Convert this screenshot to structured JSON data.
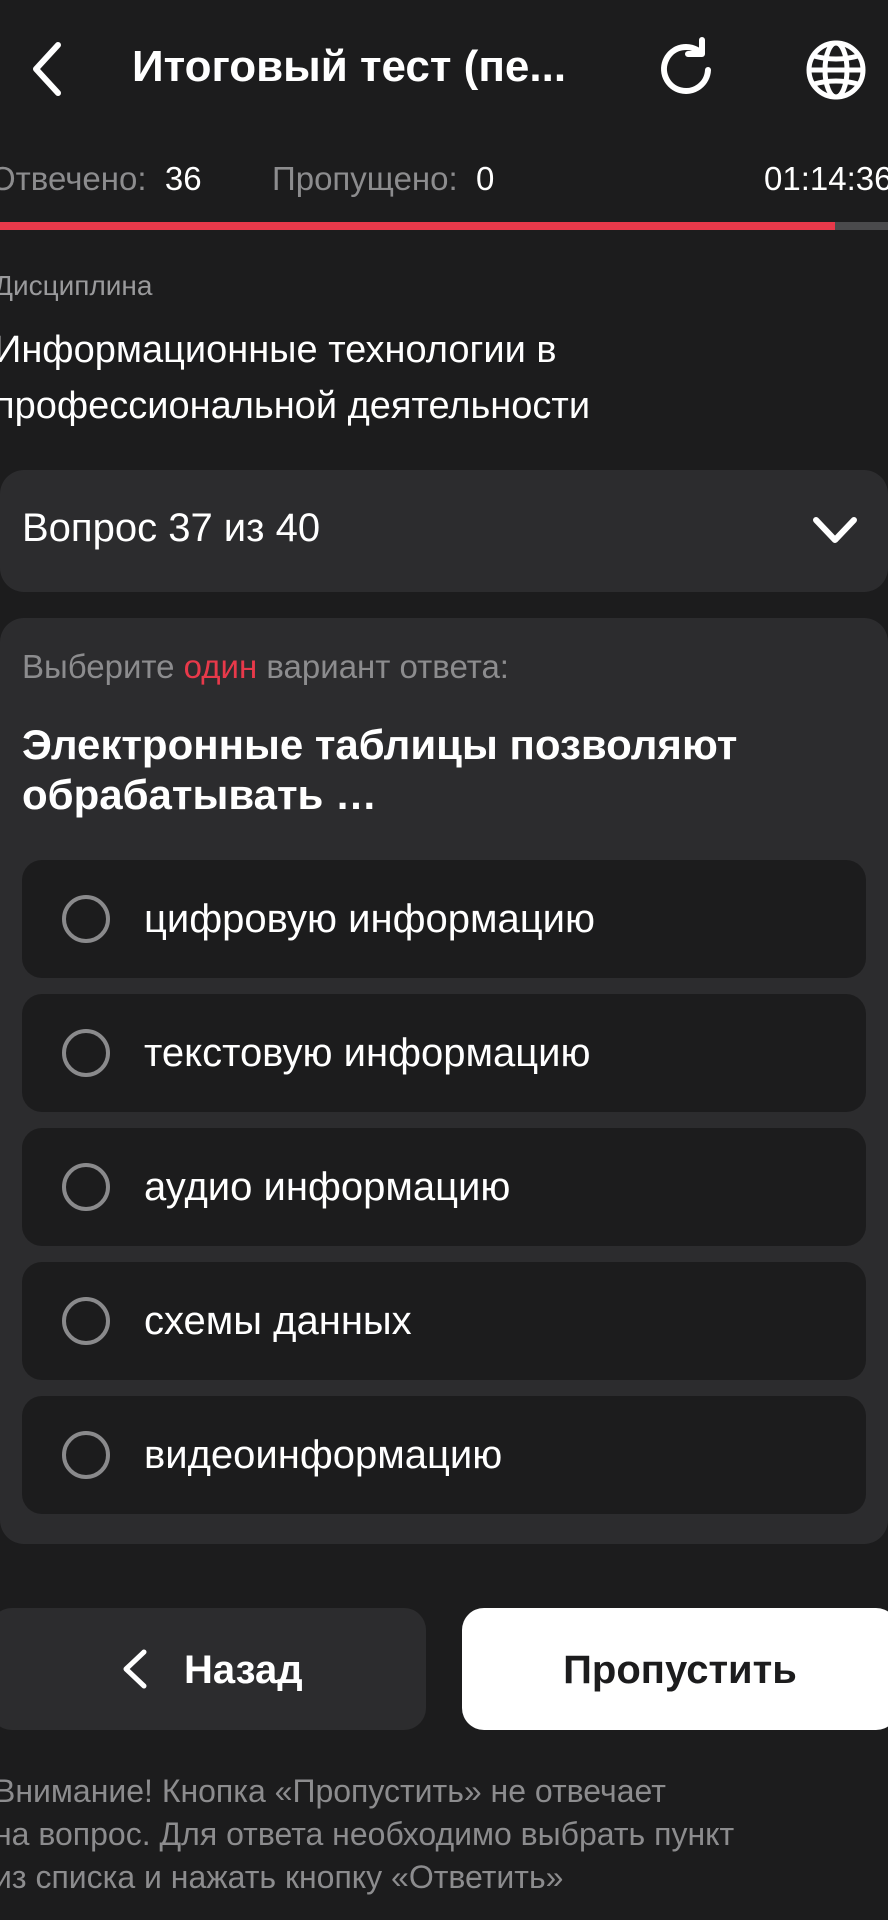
{
  "header": {
    "title": "Итоговый тест (пе...",
    "back_icon": "chevron-left-icon",
    "refresh_icon": "refresh-icon",
    "language_icon": "globe-icon"
  },
  "stats": {
    "answered_label": "Отвечено:",
    "answered_value": "36",
    "skipped_label": "Пропущено:",
    "skipped_value": "0",
    "timer": "01:14:36",
    "progress_fraction": 0.94
  },
  "discipline": {
    "label": "Дисциплина",
    "name": "Информационные технологии в профессиональной деятельности"
  },
  "question_selector": {
    "label": "Вопрос 37 из 40"
  },
  "question": {
    "instruction_before": "Выберите ",
    "instruction_accent": "один",
    "instruction_after": " вариант ответа:",
    "text": "Электронные таблицы позволяют обрабатывать …",
    "options": [
      {
        "label": "цифровую информацию"
      },
      {
        "label": "текстовую информацию"
      },
      {
        "label": "аудио информацию"
      },
      {
        "label": "схемы данных"
      },
      {
        "label": "видеоинформацию"
      }
    ]
  },
  "buttons": {
    "back_label": "Назад",
    "skip_label": "Пропустить"
  },
  "notice": {
    "line1": "Внимание! Кнопка «Пропустить» не отвечает",
    "line2": "на вопрос. Для ответа необходимо выбрать пункт",
    "line3": "из списка и нажать кнопку «Ответить»"
  },
  "colors": {
    "background": "#1c1c1d",
    "card": "#2c2c2e",
    "accent": "#e8394a",
    "muted_text": "#8c8c8e"
  }
}
